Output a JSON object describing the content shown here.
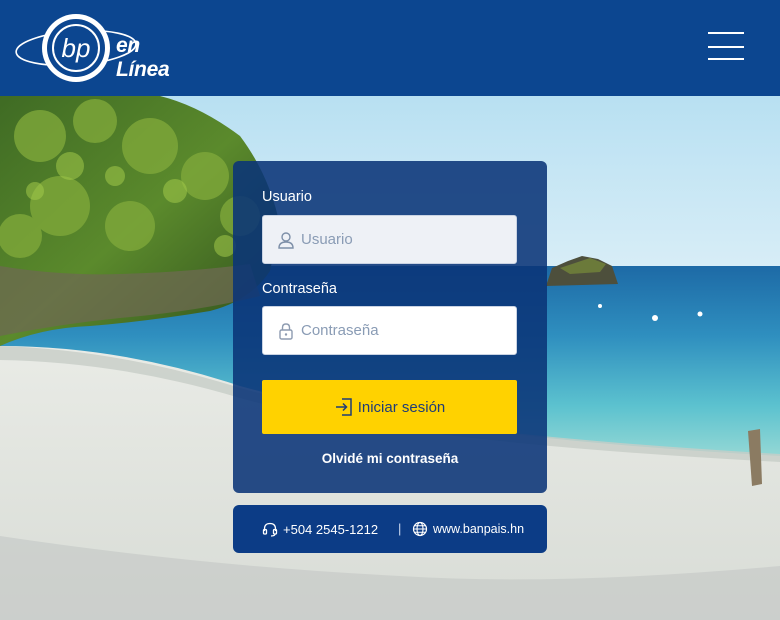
{
  "header": {
    "logo_mark": "bp",
    "logo_text": "en Línea",
    "menu_icon": "hamburger-menu-icon"
  },
  "login": {
    "username_label": "Usuario",
    "username_placeholder": "Usuario",
    "username_value": "",
    "username_icon": "user-icon",
    "password_label": "Contraseña",
    "password_placeholder": "Contraseña",
    "password_value": "",
    "password_icon": "lock-icon",
    "submit_label": "Iniciar sesión",
    "submit_icon": "sign-in-icon",
    "forgot_label": "Olvidé mi contraseña"
  },
  "contact": {
    "phone_icon": "headset-icon",
    "phone": "+504 2545-1212",
    "separator": "|",
    "web_icon": "globe-icon",
    "website": "www.banpais.hn"
  },
  "colors": {
    "header_bg": "#0c4690",
    "card_bg": "#0a3478",
    "button_bg": "#ffd200",
    "button_text": "#1f3d77"
  }
}
